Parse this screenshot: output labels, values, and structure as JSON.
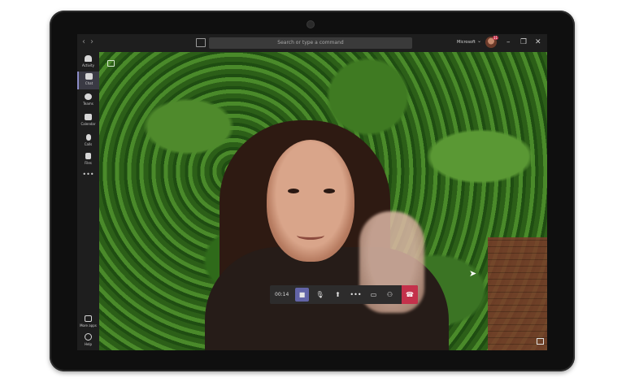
{
  "titlebar": {
    "search_placeholder": "Search or type a command",
    "tenant_name": "Microsoft",
    "back_glyph": "‹",
    "forward_glyph": "›",
    "chevron_glyph": "⌄",
    "minimize_glyph": "–",
    "maximize_glyph": "❐",
    "close_glyph": "✕",
    "notification_count": "11"
  },
  "rail": {
    "items": [
      {
        "label": "Activity",
        "icon": "bell-icon"
      },
      {
        "label": "Chat",
        "icon": "chat-icon"
      },
      {
        "label": "Teams",
        "icon": "teams-icon"
      },
      {
        "label": "Calendar",
        "icon": "calendar-icon"
      },
      {
        "label": "Calls",
        "icon": "phone-icon"
      },
      {
        "label": "Files",
        "icon": "file-icon"
      }
    ],
    "more_glyph": "•••",
    "bottom": [
      {
        "label": "More apps",
        "icon": "apps-icon"
      },
      {
        "label": "Help",
        "icon": "help-icon"
      }
    ]
  },
  "call_controls": {
    "timer": "00:14",
    "camera_glyph": "■",
    "mic_glyph": "🎙",
    "share_glyph": "⬆",
    "more_glyph": "•••",
    "chat_glyph": "▭",
    "participants_glyph": "⚇",
    "hangup_glyph": "☎"
  },
  "colors": {
    "accent": "#6264a7",
    "hangup": "#c4314b",
    "app_dark": "#1e1e1e"
  }
}
